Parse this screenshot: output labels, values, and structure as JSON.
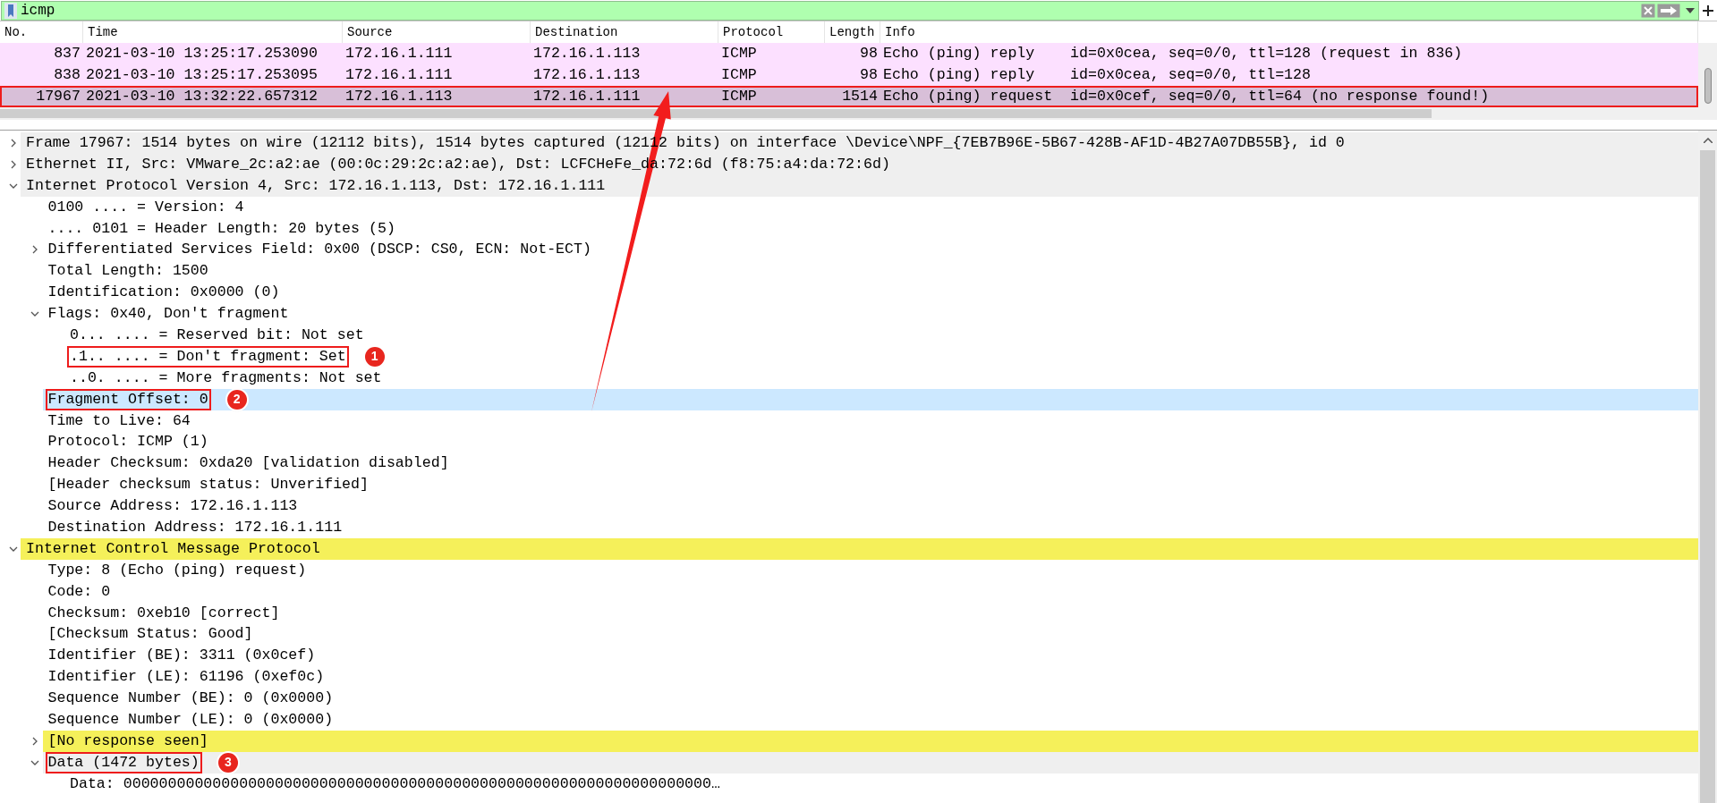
{
  "filter": {
    "value": "icmp"
  },
  "packet_list": {
    "columns": [
      "No.",
      "Time",
      "Source",
      "Destination",
      "Protocol",
      "Length",
      "Info"
    ],
    "rows": [
      {
        "cells": [
          "837",
          "2021-03-10 13:25:17.253090",
          "172.16.1.111",
          "172.16.1.113",
          "ICMP",
          "98",
          "Echo (ping) reply    id=0x0cea, seq=0/0, ttl=128 (request in 836)"
        ],
        "selected": false,
        "boxed": false
      },
      {
        "cells": [
          "838",
          "2021-03-10 13:25:17.253095",
          "172.16.1.111",
          "172.16.1.113",
          "ICMP",
          "98",
          "Echo (ping) reply    id=0x0cea, seq=0/0, ttl=128"
        ],
        "selected": false,
        "boxed": false
      },
      {
        "cells": [
          "17967",
          "2021-03-10 13:32:22.657312",
          "172.16.1.113",
          "172.16.1.111",
          "ICMP",
          "1514",
          "Echo (ping) request  id=0x0cef, seq=0/0, ttl=64 (no response found!)"
        ],
        "selected": true,
        "boxed": true
      }
    ]
  },
  "details": [
    {
      "label": "Frame 17967: 1514 bytes on wire (12112 bits), 1514 bytes captured (12112 bits) on interface \\Device\\NPF_{7EB7B96E-5B67-428B-AF1D-4B27A07DB55B}, id 0",
      "expanded": false,
      "color": "#efefef"
    },
    {
      "label": "Ethernet II, Src: VMware_2c:a2:ae (00:0c:29:2c:a2:ae), Dst: LCFCHeFe_da:72:6d (f8:75:a4:da:72:6d)",
      "expanded": false,
      "color": "#efefef"
    },
    {
      "label": "Internet Protocol Version 4, Src: 172.16.1.113, Dst: 172.16.1.111",
      "expanded": true,
      "color": "#efefef",
      "children": [
        {
          "label": "0100 .... = Version: 4"
        },
        {
          "label": ".... 0101 = Header Length: 20 bytes (5)"
        },
        {
          "label": "Differentiated Services Field: 0x00 (DSCP: CS0, ECN: Not-ECT)",
          "expanded": false
        },
        {
          "label": "Total Length: 1500"
        },
        {
          "label": "Identification: 0x0000 (0)"
        },
        {
          "label": "Flags: 0x40, Don't fragment",
          "expanded": true,
          "children": [
            {
              "label": "0... .... = Reserved bit: Not set"
            },
            {
              "label": ".1.. .... = Don't fragment: Set",
              "boxed": true,
              "callout": "1"
            },
            {
              "label": "..0. .... = More fragments: Not set"
            }
          ]
        },
        {
          "label": "Fragment Offset: 0",
          "selected": true,
          "boxed": true,
          "callout": "2"
        },
        {
          "label": "Time to Live: 64"
        },
        {
          "label": "Protocol: ICMP (1)"
        },
        {
          "label": "Header Checksum: 0xda20 [validation disabled]"
        },
        {
          "label": "[Header checksum status: Unverified]"
        },
        {
          "label": "Source Address: 172.16.1.113"
        },
        {
          "label": "Destination Address: 172.16.1.111"
        }
      ]
    },
    {
      "label": "Internet Control Message Protocol",
      "expanded": true,
      "color": "#f5f05a",
      "children": [
        {
          "label": "Type: 8 (Echo (ping) request)"
        },
        {
          "label": "Code: 0"
        },
        {
          "label": "Checksum: 0xeb10 [correct]"
        },
        {
          "label": "[Checksum Status: Good]"
        },
        {
          "label": "Identifier (BE): 3311 (0x0cef)"
        },
        {
          "label": "Identifier (LE): 61196 (0xef0c)"
        },
        {
          "label": "Sequence Number (BE): 0 (0x0000)"
        },
        {
          "label": "Sequence Number (LE): 0 (0x0000)"
        },
        {
          "label": "[No response seen]",
          "expanded": false,
          "color": "#f5f05a"
        },
        {
          "label": "Data (1472 bytes)",
          "expanded": true,
          "color": "#efefef",
          "boxed": true,
          "callout": "3",
          "children": [
            {
              "label": "Data: 000000000000000000000000000000000000000000000000000000000000000000…"
            }
          ]
        }
      ]
    }
  ]
}
